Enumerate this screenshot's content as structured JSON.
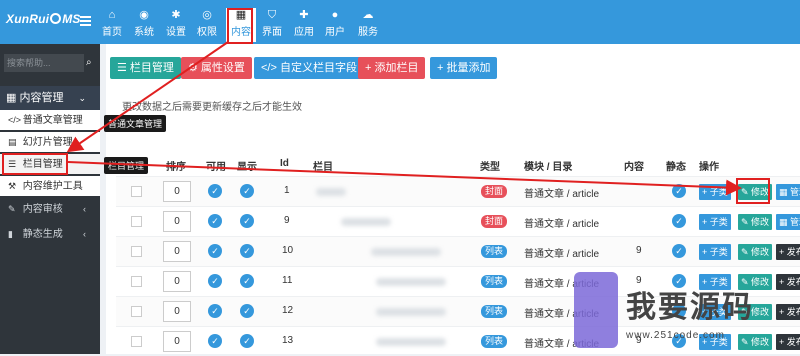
{
  "brand": {
    "pre": "XunRui",
    "post": "MS"
  },
  "nav": [
    {
      "label": "首页",
      "icon": "home-icon",
      "glyph": "⌂"
    },
    {
      "label": "系统",
      "icon": "globe-icon",
      "glyph": "◉"
    },
    {
      "label": "设置",
      "icon": "cogs-icon",
      "glyph": "✱"
    },
    {
      "label": "权限",
      "icon": "user-circle-icon",
      "glyph": "◎"
    },
    {
      "label": "内容",
      "icon": "th-large-icon",
      "glyph": "▦"
    },
    {
      "label": "界面",
      "icon": "html5-icon",
      "glyph": "⛉"
    },
    {
      "label": "应用",
      "icon": "puzzle-icon",
      "glyph": "✚"
    },
    {
      "label": "用户",
      "icon": "user-icon",
      "glyph": "●"
    },
    {
      "label": "服务",
      "icon": "cloud-icon",
      "glyph": "☁"
    }
  ],
  "sidebar": {
    "search_placeholder": "搜索帮助...",
    "section": "内容管理",
    "items": [
      {
        "label": "普通文章管理",
        "glyph": "</>"
      },
      {
        "label": "幻灯片管理",
        "glyph": "▤"
      },
      {
        "label": "栏目管理",
        "glyph": "☰"
      },
      {
        "label": "内容维护工具",
        "glyph": "⚒"
      },
      {
        "label": "内容审核",
        "glyph": "✎"
      },
      {
        "label": "静态生成",
        "glyph": "▮"
      }
    ],
    "tooltip_article": "普通文章管理",
    "tooltip_column": "栏目管理"
  },
  "toolbar": {
    "column_manage": "☰ 栏目管理",
    "attr_settings": "⚙ 属性设置",
    "custom_fields": "</> 自定义栏目字段",
    "add_column": "+ 添加栏目",
    "batch_add": "+ 批量添加"
  },
  "notice": "更改数据之后需要更新缓存之后才能生效",
  "table": {
    "headers": {
      "order": "排序",
      "usable": "可用",
      "show": "显示",
      "id": "Id",
      "column": "栏目",
      "type": "类型",
      "module": "模块 / 目录",
      "content": "内容",
      "static": "静态",
      "action": "操作"
    },
    "rows": [
      {
        "order": "0",
        "id": "1",
        "type": "封面",
        "module": "普通文章 / article",
        "content": "",
        "sub": "+ 子类",
        "edit": "✎ 修改",
        "extra": "▦ 管理"
      },
      {
        "order": "0",
        "id": "9",
        "type": "封面",
        "module": "普通文章 / article",
        "content": "",
        "sub": "+ 子类",
        "edit": "✎ 修改",
        "extra": "▦ 管理"
      },
      {
        "order": "0",
        "id": "10",
        "type": "列表",
        "module": "普通文章 / article",
        "content": "9",
        "sub": "+ 子类",
        "edit": "✎ 修改",
        "extra": "+ 发布"
      },
      {
        "order": "0",
        "id": "11",
        "type": "列表",
        "module": "普通文章 / article",
        "content": "9",
        "sub": "+ 子类",
        "edit": "✎ 修改",
        "extra": "+ 发布"
      },
      {
        "order": "0",
        "id": "12",
        "type": "列表",
        "module": "普通文章 / article",
        "content": "9",
        "sub": "+ 子类",
        "edit": "✎ 修改",
        "extra": "+ 发布"
      },
      {
        "order": "0",
        "id": "13",
        "type": "列表",
        "module": "普通文章 / article",
        "content": "9",
        "sub": "+ 子类",
        "edit": "✎ 修改",
        "extra": "+ 发布"
      }
    ]
  },
  "watermark": {
    "text": "我要源码",
    "url": "www.251code.com"
  },
  "colors": {
    "primary": "#3598dc",
    "green": "#26a69a",
    "red": "#e7505a",
    "cover": "#e7505a",
    "list": "#3598dc",
    "dark": "#2f353b"
  }
}
